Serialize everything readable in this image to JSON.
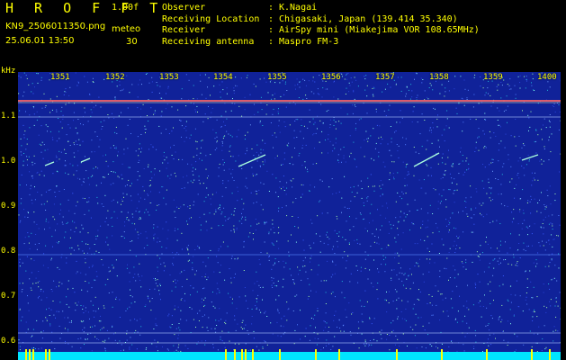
{
  "header": {
    "app_title": "H R O F F T",
    "version": "1.00f",
    "filename": "KN9_2506011350.png",
    "timestamp": "25.06.01 13:50",
    "mode": "meteo",
    "count": "30",
    "info": [
      {
        "key": "Observer",
        "value": "K.Nagai"
      },
      {
        "key": "Receiving Location",
        "value": "Chigasaki, Japan (139.414 35.340)"
      },
      {
        "key": "Receiver",
        "value": "AirSpy mini (Miakejima VOR 108.65MHz)"
      },
      {
        "key": "Receiving antenna",
        "value": "Maspro FM-3"
      }
    ]
  },
  "axis": {
    "unit": "kHz",
    "y_labels": [
      "1.1",
      "1.0",
      "0.9",
      "0.8",
      "0.7",
      "0.6"
    ],
    "x_labels": [
      "1351",
      "1352",
      "1353",
      "1354",
      "1355",
      "1356",
      "1357",
      "1358",
      "1359",
      "1400"
    ]
  },
  "colors": {
    "background": "#102299",
    "text": "#ffff00",
    "reference_line": "#ff6666",
    "baseline": "#00e5ff"
  }
}
